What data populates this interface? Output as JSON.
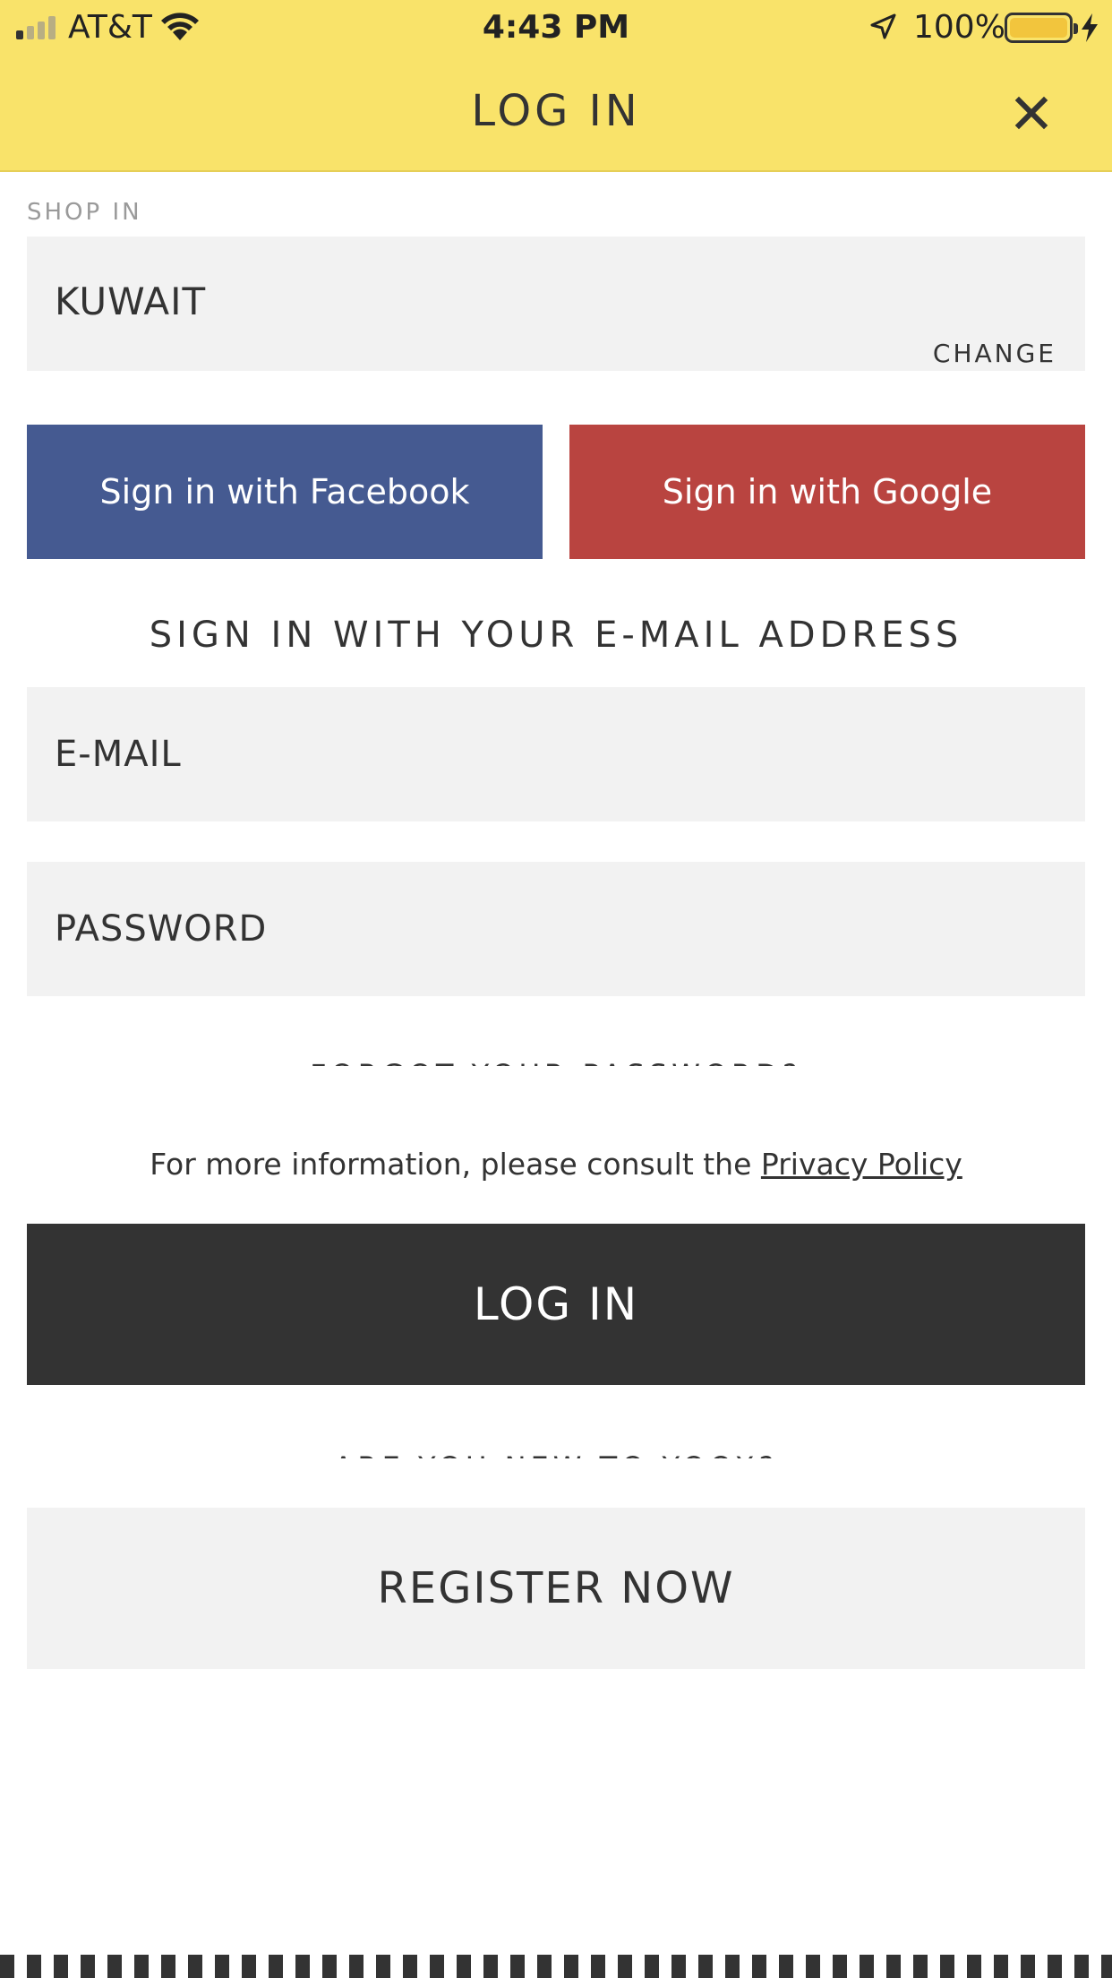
{
  "status_bar": {
    "carrier": "AT&T",
    "time": "4:43 PM",
    "battery_percent": "100%",
    "icons": [
      "signal-icon",
      "wifi-icon",
      "location-arrow-icon",
      "battery-icon",
      "charging-bolt-icon"
    ]
  },
  "header": {
    "title": "LOG IN",
    "close_icon": "close-icon",
    "background": "#f9e36a"
  },
  "shop_in": {
    "label": "SHOP IN",
    "country": "KUWAIT",
    "change_label": "CHANGE"
  },
  "social": {
    "facebook_label": "Sign in with Facebook",
    "facebook_color": "#455a91",
    "google_label": "Sign in with Google",
    "google_color": "#b94440"
  },
  "email_section": {
    "heading": "SIGN IN WITH YOUR E-MAIL ADDRESS",
    "email_placeholder": "E-MAIL",
    "password_placeholder": "PASSWORD",
    "forgot_label": "FORGOT YOUR PASSWORD?"
  },
  "privacy": {
    "text": "For more information, please consult the ",
    "link": "Privacy Policy"
  },
  "login_button": {
    "label": "LOG IN",
    "color": "#333333"
  },
  "register": {
    "question": "ARE YOU NEW TO YOOX?",
    "button_label": "REGISTER NOW"
  }
}
